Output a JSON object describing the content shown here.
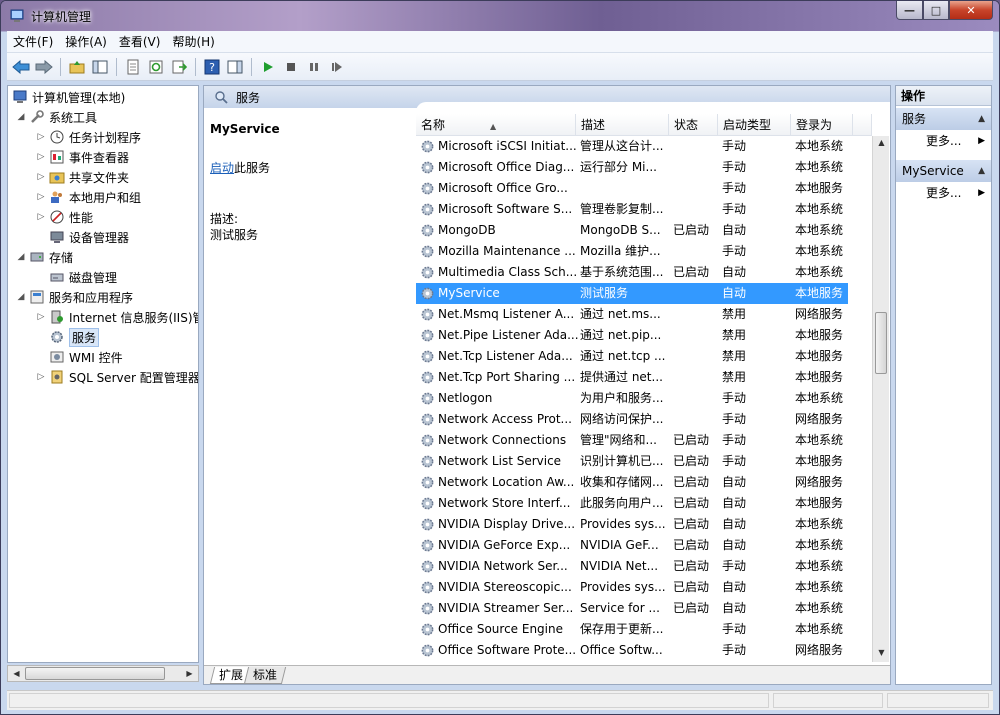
{
  "window": {
    "title": "计算机管理"
  },
  "menu": [
    "文件(F)",
    "操作(A)",
    "查看(V)",
    "帮助(H)"
  ],
  "tree": [
    {
      "label": "计算机管理(本地)",
      "indent": 0,
      "icon": "computer-icon",
      "expander": ""
    },
    {
      "label": "系统工具",
      "indent": 1,
      "icon": "tools-icon",
      "expander": "▲"
    },
    {
      "label": "任务计划程序",
      "indent": 2,
      "icon": "clock-icon",
      "expander": "▷"
    },
    {
      "label": "事件查看器",
      "indent": 2,
      "icon": "event-viewer-icon",
      "expander": "▷"
    },
    {
      "label": "共享文件夹",
      "indent": 2,
      "icon": "shared-folder-icon",
      "expander": "▷"
    },
    {
      "label": "本地用户和组",
      "indent": 2,
      "icon": "users-icon",
      "expander": "▷"
    },
    {
      "label": "性能",
      "indent": 2,
      "icon": "performance-icon",
      "expander": "▷"
    },
    {
      "label": "设备管理器",
      "indent": 2,
      "icon": "device-manager-icon",
      "expander": ""
    },
    {
      "label": "存储",
      "indent": 1,
      "icon": "storage-icon",
      "expander": "▲"
    },
    {
      "label": "磁盘管理",
      "indent": 2,
      "icon": "disk-icon",
      "expander": ""
    },
    {
      "label": "服务和应用程序",
      "indent": 1,
      "icon": "apps-icon",
      "expander": "▲"
    },
    {
      "label": "Internet 信息服务(IIS)管",
      "indent": 2,
      "icon": "iis-icon",
      "expander": "▷"
    },
    {
      "label": "服务",
      "indent": 2,
      "icon": "services-gear-icon",
      "expander": "",
      "selected": true
    },
    {
      "label": "WMI 控件",
      "indent": 2,
      "icon": "wmi-icon",
      "expander": ""
    },
    {
      "label": "SQL Server 配置管理器",
      "indent": 2,
      "icon": "sql-icon",
      "expander": "▷"
    }
  ],
  "center": {
    "header": "服务",
    "selected_name": "MyService",
    "start_link": "启动",
    "start_suffix": "此服务",
    "desc_label": "描述:",
    "desc_text": "测试服务"
  },
  "columns": {
    "name": "名称",
    "desc": "描述",
    "status": "状态",
    "startup": "启动类型",
    "logon": "登录为"
  },
  "services": [
    {
      "name": "Microsoft iSCSI Initiat...",
      "desc": "管理从这台计...",
      "status": "",
      "startup": "手动",
      "logon": "本地系统"
    },
    {
      "name": "Microsoft Office Diag...",
      "desc": "运行部分 Mi...",
      "status": "",
      "startup": "手动",
      "logon": "本地系统"
    },
    {
      "name": "Microsoft Office Gro...",
      "desc": "",
      "status": "",
      "startup": "手动",
      "logon": "本地服务"
    },
    {
      "name": "Microsoft Software S...",
      "desc": "管理卷影复制...",
      "status": "",
      "startup": "手动",
      "logon": "本地系统"
    },
    {
      "name": "MongoDB",
      "desc": "MongoDB S...",
      "status": "已启动",
      "startup": "自动",
      "logon": "本地系统"
    },
    {
      "name": "Mozilla Maintenance ...",
      "desc": "Mozilla 维护...",
      "status": "",
      "startup": "手动",
      "logon": "本地系统"
    },
    {
      "name": "Multimedia Class Sch...",
      "desc": "基于系统范围...",
      "status": "已启动",
      "startup": "自动",
      "logon": "本地系统"
    },
    {
      "name": "MyService",
      "desc": "测试服务",
      "status": "",
      "startup": "自动",
      "logon": "本地服务",
      "selected": true
    },
    {
      "name": "Net.Msmq Listener A...",
      "desc": "通过 net.ms...",
      "status": "",
      "startup": "禁用",
      "logon": "网络服务"
    },
    {
      "name": "Net.Pipe Listener Ada...",
      "desc": "通过 net.pip...",
      "status": "",
      "startup": "禁用",
      "logon": "本地服务"
    },
    {
      "name": "Net.Tcp Listener Ada...",
      "desc": "通过 net.tcp ...",
      "status": "",
      "startup": "禁用",
      "logon": "本地服务"
    },
    {
      "name": "Net.Tcp Port Sharing ...",
      "desc": "提供通过 net...",
      "status": "",
      "startup": "禁用",
      "logon": "本地服务"
    },
    {
      "name": "Netlogon",
      "desc": "为用户和服务...",
      "status": "",
      "startup": "手动",
      "logon": "本地系统"
    },
    {
      "name": "Network Access Prot...",
      "desc": "网络访问保护...",
      "status": "",
      "startup": "手动",
      "logon": "网络服务"
    },
    {
      "name": "Network Connections",
      "desc": "管理\"网络和...",
      "status": "已启动",
      "startup": "手动",
      "logon": "本地系统"
    },
    {
      "name": "Network List Service",
      "desc": "识别计算机已...",
      "status": "已启动",
      "startup": "手动",
      "logon": "本地服务"
    },
    {
      "name": "Network Location Aw...",
      "desc": "收集和存储网...",
      "status": "已启动",
      "startup": "自动",
      "logon": "网络服务"
    },
    {
      "name": "Network Store Interf...",
      "desc": "此服务向用户...",
      "status": "已启动",
      "startup": "自动",
      "logon": "本地服务"
    },
    {
      "name": "NVIDIA Display Drive...",
      "desc": "Provides sys...",
      "status": "已启动",
      "startup": "自动",
      "logon": "本地系统"
    },
    {
      "name": "NVIDIA GeForce Exp...",
      "desc": "NVIDIA GeF...",
      "status": "已启动",
      "startup": "自动",
      "logon": "本地系统"
    },
    {
      "name": "NVIDIA Network Ser...",
      "desc": "NVIDIA Net...",
      "status": "已启动",
      "startup": "手动",
      "logon": "本地系统"
    },
    {
      "name": "NVIDIA Stereoscopic...",
      "desc": "Provides sys...",
      "status": "已启动",
      "startup": "自动",
      "logon": "本地系统"
    },
    {
      "name": "NVIDIA Streamer Ser...",
      "desc": "Service for ...",
      "status": "已启动",
      "startup": "自动",
      "logon": "本地系统"
    },
    {
      "name": "Office  Source Engine",
      "desc": "保存用于更新...",
      "status": "",
      "startup": "手动",
      "logon": "本地系统"
    },
    {
      "name": "Office Software Prote...",
      "desc": "Office Softw...",
      "status": "",
      "startup": "手动",
      "logon": "网络服务"
    }
  ],
  "tabs": [
    "扩展",
    "标准"
  ],
  "actions": {
    "header": "操作",
    "sections": [
      {
        "title": "服务",
        "more": "更多..."
      },
      {
        "title": "MyService",
        "more": "更多..."
      }
    ]
  }
}
